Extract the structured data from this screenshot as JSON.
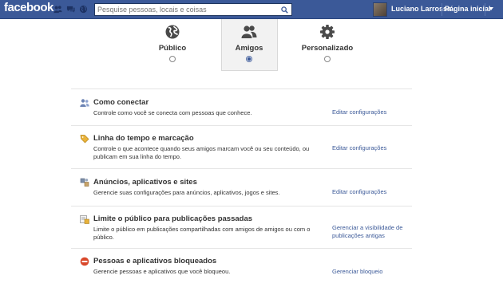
{
  "topbar": {
    "logo": "facebook",
    "search_placeholder": "Pesquise pessoas, locais e coisas",
    "user_name": "Luciano Larrossa",
    "home_label": "Página inicial"
  },
  "audience": {
    "options": [
      {
        "label": "Público",
        "icon": "globe-icon",
        "selected": false
      },
      {
        "label": "Amigos",
        "icon": "friends-icon",
        "selected": true
      },
      {
        "label": "Personalizado",
        "icon": "gear-icon",
        "selected": false
      }
    ]
  },
  "settings": [
    {
      "title": "Como conectar",
      "description": "Controle como você se conecta com pessoas que conhece.",
      "link": "Editar configurações",
      "icon": "people-icon"
    },
    {
      "title": "Linha do tempo e marcação",
      "description": "Controle o que acontece quando seus amigos marcam você ou seu conteúdo, ou publicam em sua linha do tempo.",
      "link": "Editar configurações",
      "icon": "tag-icon"
    },
    {
      "title": "Anúncios, aplicativos e sites",
      "description": "Gerencie suas configurações para anúncios, aplicativos, jogos e sites.",
      "link": "Editar configurações",
      "icon": "apps-icon"
    },
    {
      "title": "Limite o público para publicações passadas",
      "description": "Limite o público em publicações compartilhadas com amigos de amigos ou com o público.",
      "link": "Gerenciar a visibilidade de publicações antigas",
      "icon": "past-posts-icon"
    },
    {
      "title": "Pessoas e aplicativos bloqueados",
      "description": "Gerencie pessoas e aplicativos que você bloqueou.",
      "link": "Gerenciar bloqueio",
      "icon": "block-icon"
    }
  ],
  "colors": {
    "brand": "#3b5998",
    "link": "#3b5998",
    "block": "#d9482b"
  }
}
